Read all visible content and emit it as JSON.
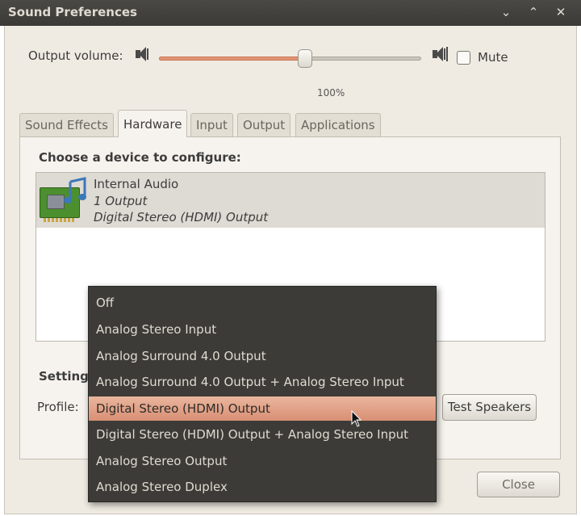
{
  "window": {
    "title": "Sound Preferences"
  },
  "volume": {
    "label": "Output volume:",
    "level_percent": 100,
    "percent_text": "100%",
    "mute_label": "Mute",
    "muted": false
  },
  "tabs": [
    {
      "label": "Sound Effects",
      "active": false
    },
    {
      "label": "Hardware",
      "active": true
    },
    {
      "label": "Input",
      "active": false
    },
    {
      "label": "Output",
      "active": false
    },
    {
      "label": "Applications",
      "active": false
    }
  ],
  "hardware": {
    "choose_label": "Choose a device to configure:",
    "device": {
      "name": "Internal Audio",
      "outputs": "1 Output",
      "profile": "Digital Stereo (HDMI) Output"
    },
    "settings_label": "Setting",
    "profile_label": "Profile:",
    "test_speakers_label": "Test Speakers"
  },
  "profile_menu": {
    "items": [
      "Off",
      "Analog Stereo Input",
      "Analog Surround 4.0 Output",
      "Analog Surround 4.0 Output + Analog Stereo Input",
      "Digital Stereo (HDMI) Output",
      "Digital Stereo (HDMI) Output + Analog Stereo Input",
      "Analog Stereo Output",
      "Analog Stereo Duplex"
    ],
    "selected": "Digital Stereo (HDMI) Output"
  },
  "close_label": "Close",
  "colors": {
    "accent": "#e39474",
    "titlebar": "#3b3a36",
    "window_bg": "#f0ebe2"
  },
  "icons": [
    "minimize-icon",
    "maximize-icon",
    "close-icon",
    "speaker-low-icon",
    "speaker-high-icon",
    "sound-card-icon",
    "mouse-cursor-icon"
  ]
}
